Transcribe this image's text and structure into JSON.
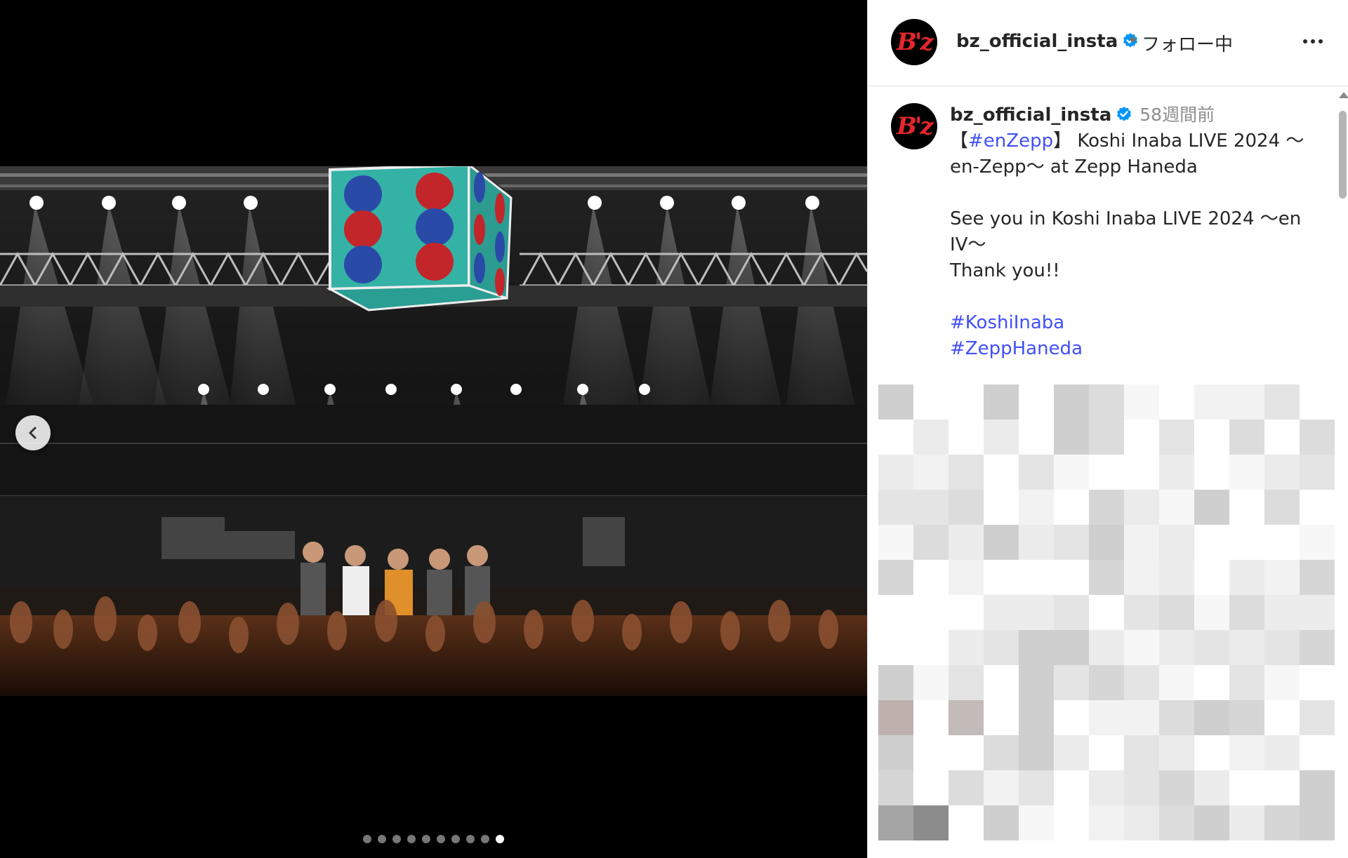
{
  "post": {
    "username": "bz_official_insta",
    "follow_status": "フォロー中",
    "separator": "•",
    "avatar_logo": "B'z",
    "time_ago": "58週間前",
    "caption": {
      "line1_prefix": "【",
      "hashtag_enzepp": "#enZepp",
      "line1_suffix": "】 Koshi Inaba LIVE 2024 〜en-Zepp〜 at Zepp Haneda",
      "line2": "See you in Koshi Inaba LIVE 2024 〜en IV〜",
      "line3": "Thank you!!",
      "hashtag1": "#KoshiInaba",
      "hashtag2": "#ZeppHaneda"
    }
  },
  "carousel": {
    "total": 10,
    "active_index": 9
  },
  "icons": {
    "prev": "chevron-left-icon",
    "verified": "verified-badge-icon",
    "more": "more-options-icon"
  },
  "colors": {
    "hashtag": "#4150f7",
    "verified": "#0095f6",
    "brand_logo": "#e5262d"
  }
}
